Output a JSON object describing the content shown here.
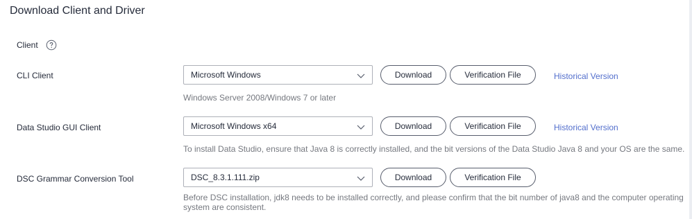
{
  "page_title": "Download Client and Driver",
  "section_label": "Client",
  "rows": [
    {
      "label": "CLI Client",
      "select_value": "Microsoft Windows",
      "download_label": "Download",
      "verify_label": "Verification File",
      "link_label": "Historical Version",
      "note": "Windows Server 2008/Windows 7 or later"
    },
    {
      "label": "Data Studio GUI Client",
      "select_value": "Microsoft Windows x64",
      "download_label": "Download",
      "verify_label": "Verification File",
      "link_label": "Historical Version",
      "note": "To install Data Studio, ensure that Java 8 is correctly installed, and the bit versions of the Data Studio Java 8 and your OS are the same."
    },
    {
      "label": "DSC Grammar Conversion Tool",
      "select_value": "DSC_8.3.1.111.zip",
      "download_label": "Download",
      "verify_label": "Verification File",
      "note_line1": "Before DSC installation, jdk8 needs to be installed correctly, and please confirm that the bit number of java8 and the computer operating",
      "note_line2": "system are consistent."
    }
  ],
  "colors": {
    "link": "#526ecc",
    "note": "#75787f",
    "text": "#252b3a"
  }
}
